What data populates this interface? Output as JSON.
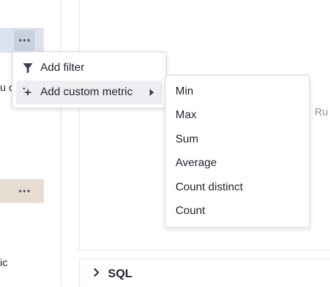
{
  "left_panel": {
    "row_1_text": "u c",
    "row_2_text": "ic",
    "more_icon": "more-horizontal-icon"
  },
  "main": {
    "run_hint": "Ru"
  },
  "sql_section": {
    "label": "SQL",
    "icon": "chevron-right-icon"
  },
  "context_menu": {
    "items": [
      {
        "label": "Add filter",
        "icon": "filter-icon"
      },
      {
        "label": "Add custom metric",
        "icon": "sparkles-icon",
        "has_submenu": true
      }
    ]
  },
  "submenu": {
    "items": [
      "Min",
      "Max",
      "Sum",
      "Average",
      "Count distinct",
      "Count"
    ]
  },
  "colors": {
    "row_1_bg": "#dde3ee",
    "row_2_bg": "#e6ddd2",
    "hover_bg": "#eceef1"
  }
}
